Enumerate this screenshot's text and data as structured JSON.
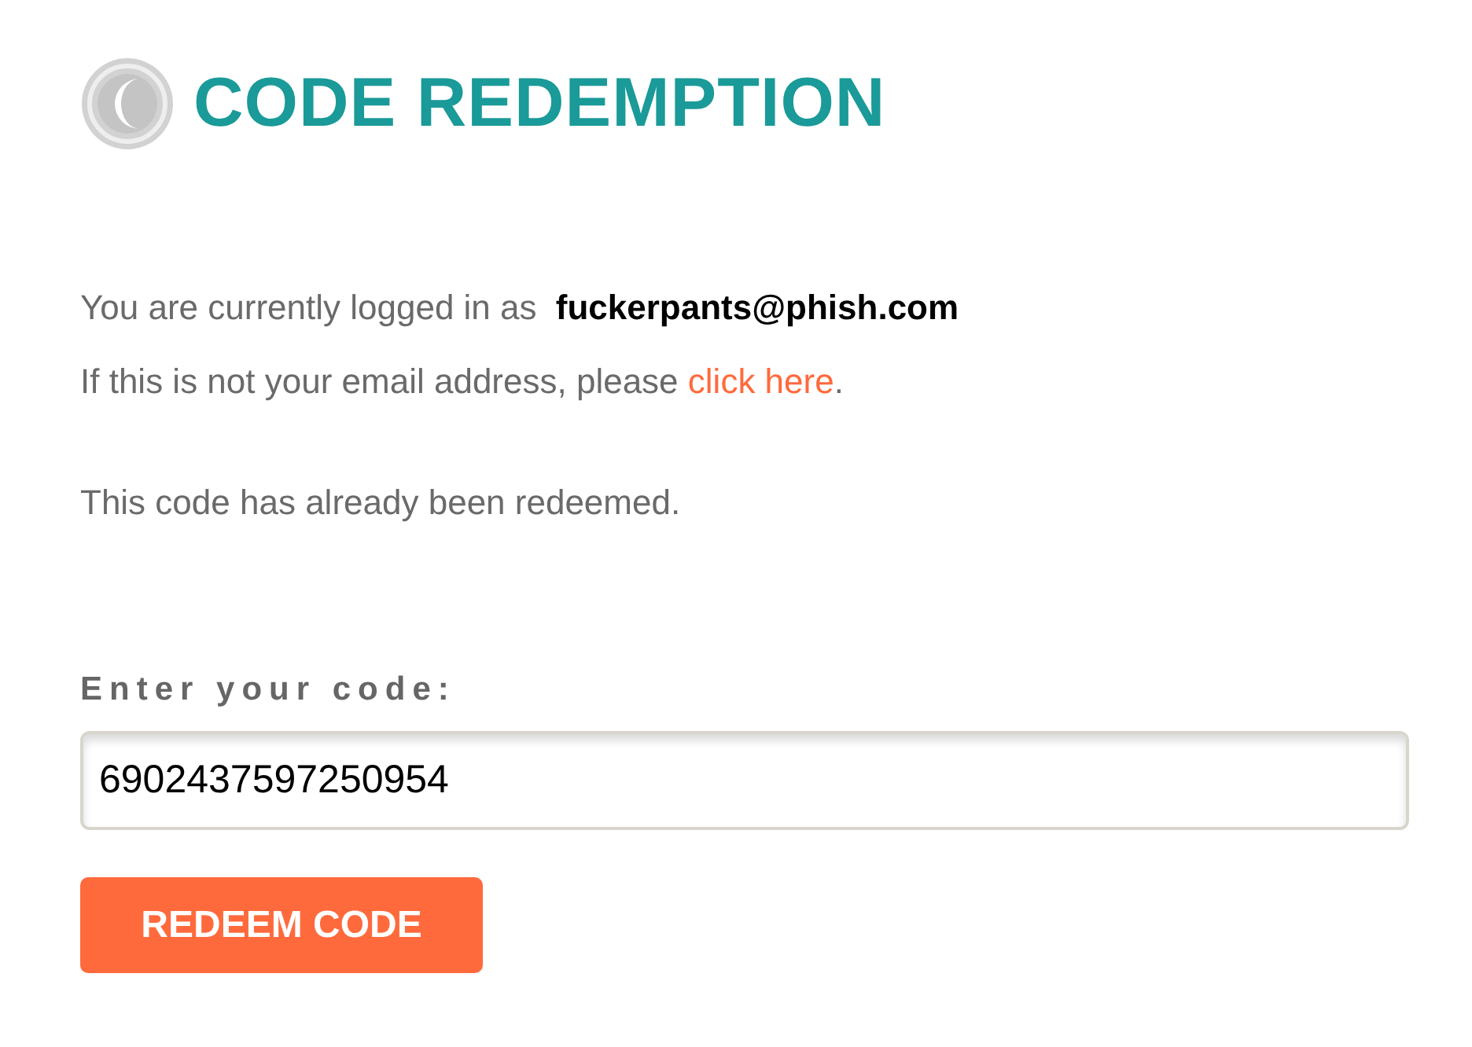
{
  "header": {
    "title": "CODE REDEMPTION"
  },
  "login_info": {
    "text": "You are currently logged in as **fuckerpants@phish.com**",
    "prompt_before": "If this is not your email address, please ",
    "link": "click here",
    "prompt_after": "."
  },
  "status_message": "This code has already been redeemed.",
  "form": {
    "label": "Enter your code:",
    "code_value": "6902437597250954",
    "button": "REDEEM CODE"
  }
}
